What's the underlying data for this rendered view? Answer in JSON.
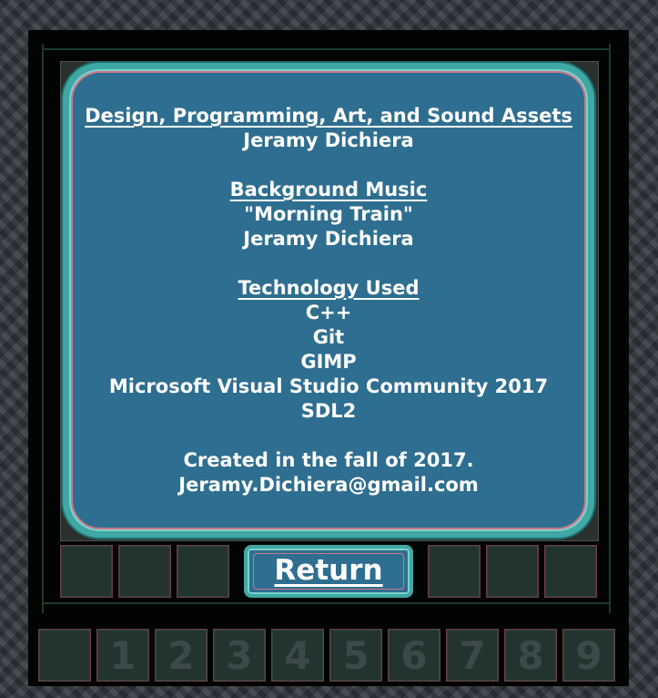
{
  "credits": {
    "design_heading": "Design, Programming, Art, and Sound Assets",
    "design_name": "Jeramy Dichiera",
    "music_heading": "Background Music",
    "music_title": "\"Morning Train\"",
    "music_name": "Jeramy Dichiera",
    "tech_heading": "Technology Used",
    "tech_items": [
      "C++",
      "Git",
      "GIMP",
      "Microsoft Visual Studio Community 2017",
      "SDL2"
    ],
    "created": "Created in the fall of 2017.",
    "email": "Jeramy.Dichiera@gmail.com"
  },
  "return_label": "Return",
  "number_keys": [
    "",
    "1",
    "2",
    "3",
    "4",
    "5",
    "6",
    "7",
    "8",
    "9"
  ],
  "colors": {
    "panel": "#2e6e90",
    "panel_border": "#3fa7a4",
    "inner_border": "#c8788a",
    "slot": "#223330",
    "board": "#020403"
  }
}
